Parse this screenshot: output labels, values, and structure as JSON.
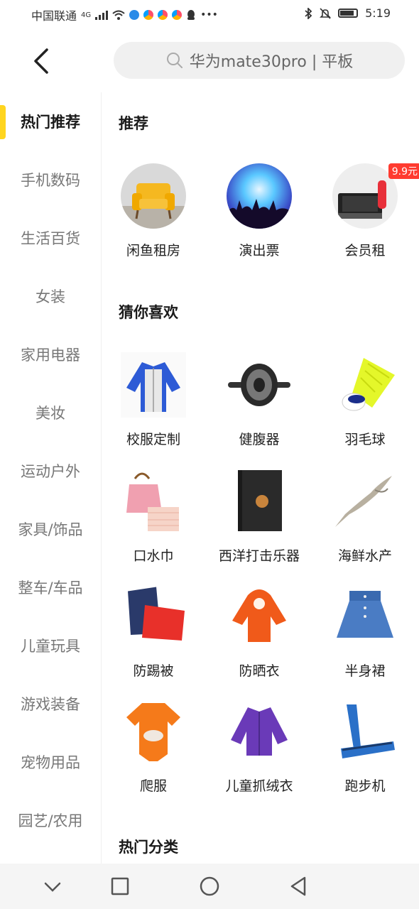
{
  "status_bar": {
    "carrier": "中国联通",
    "network": "4G",
    "time": "5:19"
  },
  "search": {
    "placeholder": "华为mate30pro  |  平板"
  },
  "sidebar": {
    "items": [
      {
        "label": "热门推荐",
        "active": true
      },
      {
        "label": "手机数码"
      },
      {
        "label": "生活百货"
      },
      {
        "label": "女装"
      },
      {
        "label": "家用电器"
      },
      {
        "label": "美妆"
      },
      {
        "label": "运动户外"
      },
      {
        "label": "家具/饰品"
      },
      {
        "label": "整车/车品"
      },
      {
        "label": "儿童玩具"
      },
      {
        "label": "游戏装备"
      },
      {
        "label": "宠物用品"
      },
      {
        "label": "园艺/农用"
      }
    ]
  },
  "sections": {
    "recommend": {
      "title": "推荐",
      "items": [
        {
          "label": "闲鱼租房",
          "icon": "yellow-armchair"
        },
        {
          "label": "演出票",
          "icon": "concert-crowd"
        },
        {
          "label": "会员租",
          "icon": "game-console",
          "badge": "9.9元"
        }
      ]
    },
    "guess": {
      "title": "猜你喜欢",
      "items": [
        {
          "label": "校服定制",
          "icon": "school-jacket"
        },
        {
          "label": "健腹器",
          "icon": "ab-wheel"
        },
        {
          "label": "羽毛球",
          "icon": "shuttlecock"
        },
        {
          "label": "口水巾",
          "icon": "bib-bag"
        },
        {
          "label": "西洋打击乐器",
          "icon": "cajon-drum"
        },
        {
          "label": "海鲜水产",
          "icon": "dried-fish"
        },
        {
          "label": "防踢被",
          "icon": "sleeping-bag"
        },
        {
          "label": "防晒衣",
          "icon": "orange-jacket"
        },
        {
          "label": "半身裙",
          "icon": "denim-skirt"
        },
        {
          "label": "爬服",
          "icon": "baby-romper"
        },
        {
          "label": "儿童抓绒衣",
          "icon": "purple-fleece"
        },
        {
          "label": "跑步机",
          "icon": "treadmill"
        }
      ]
    },
    "hot_category": {
      "title": "热门分类"
    }
  },
  "colors": {
    "accent": "#ffd51f",
    "badge": "#ff3b30"
  }
}
